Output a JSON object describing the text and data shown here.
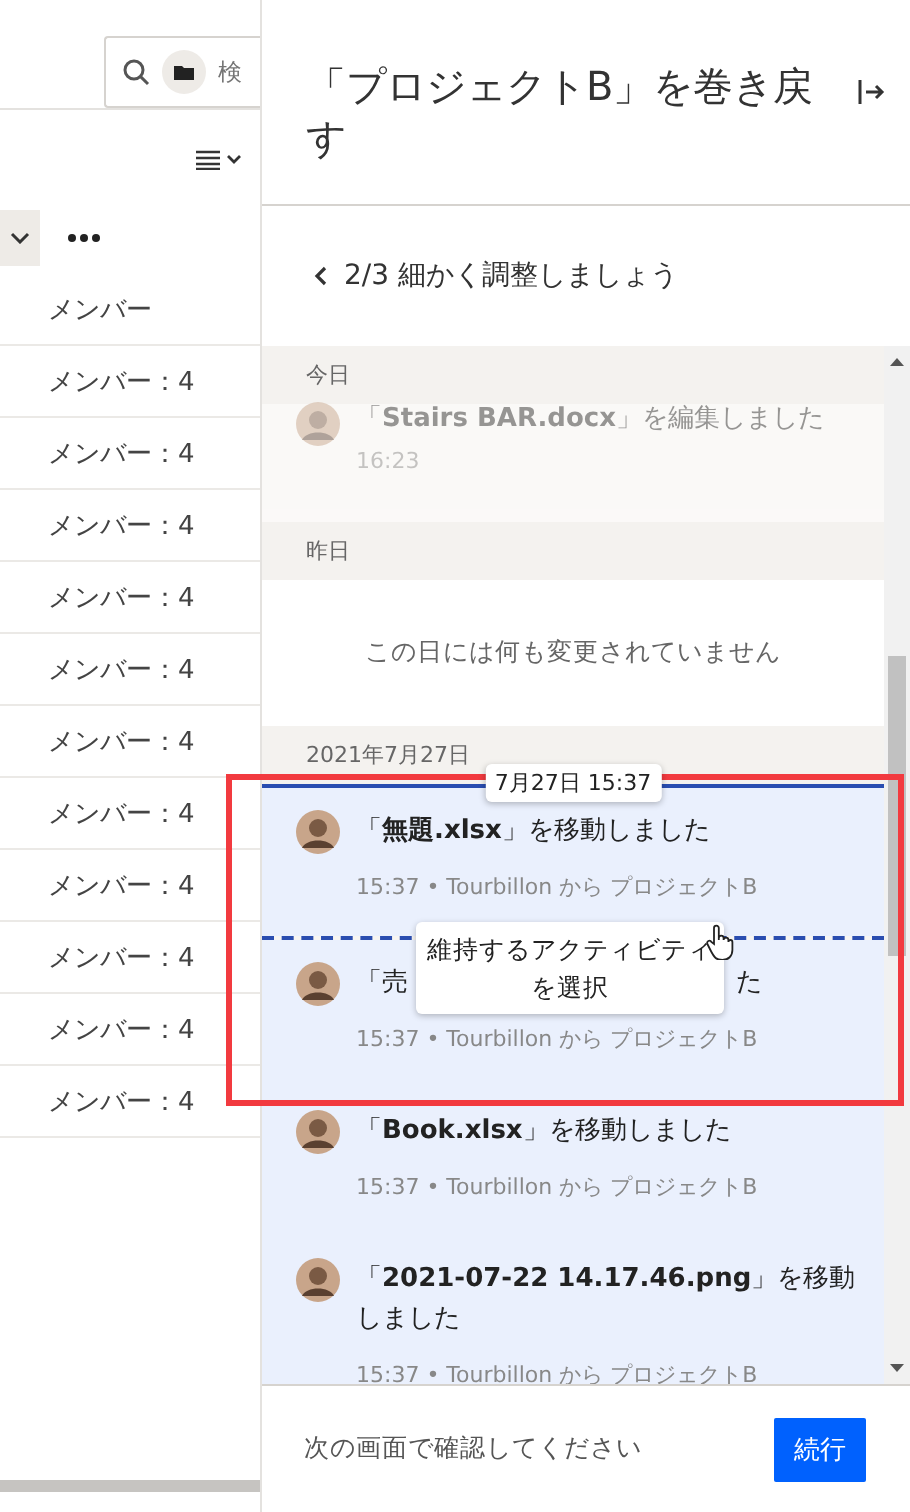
{
  "background_page": {
    "search": {
      "placeholder": "検"
    },
    "table": {
      "header": "メンバー",
      "rows": [
        "メンバー：4",
        "メンバー：4",
        "メンバー：4",
        "メンバー：4",
        "メンバー：4",
        "メンバー：4",
        "メンバー：4",
        "メンバー：4",
        "メンバー：4",
        "メンバー：4",
        "メンバー：4"
      ]
    }
  },
  "panel": {
    "title": "「プロジェクトB」を巻き戻す",
    "step": "2/3 細かく調整しましょう",
    "timeline": [
      {
        "kind": "header",
        "label": "今日"
      },
      {
        "kind": "activity",
        "dimmed": true,
        "selected": false,
        "title_parts": [
          "「**Stairs BAR.docx**」を編集しました"
        ],
        "meta": "16:23"
      },
      {
        "kind": "header",
        "label": "昨日"
      },
      {
        "kind": "empty",
        "label": "この日には何も変更されていません"
      },
      {
        "kind": "header",
        "label": "2021年7月27日"
      },
      {
        "kind": "start-marker",
        "label": "7月27日 15:37"
      },
      {
        "kind": "activity",
        "dimmed": false,
        "selected": true,
        "title_parts": [
          "「**無題.xlsx**」を移動しました"
        ],
        "meta": "15:37 • Tourbillon から プロジェクトB"
      },
      {
        "kind": "end-marker",
        "label": "維持するアクティビティを選択"
      },
      {
        "kind": "activity",
        "dimmed": false,
        "selected": true,
        "title_parts": [
          "「売",
          "た"
        ],
        "meta": "15:37 • Tourbillon から プロジェクトB"
      },
      {
        "kind": "activity",
        "dimmed": false,
        "selected": true,
        "title_parts": [
          "「**Book.xlsx**」を移動しました"
        ],
        "meta": "15:37 • Tourbillon から プロジェクトB"
      },
      {
        "kind": "activity",
        "dimmed": false,
        "selected": true,
        "title_parts": [
          "「**2021-07-22 14.17.46.png**」を移動しました"
        ],
        "meta": "15:37 • Tourbillon から プロジェクトB"
      }
    ],
    "footer": {
      "note": "次の画面で確認してください",
      "button": "続行"
    }
  }
}
